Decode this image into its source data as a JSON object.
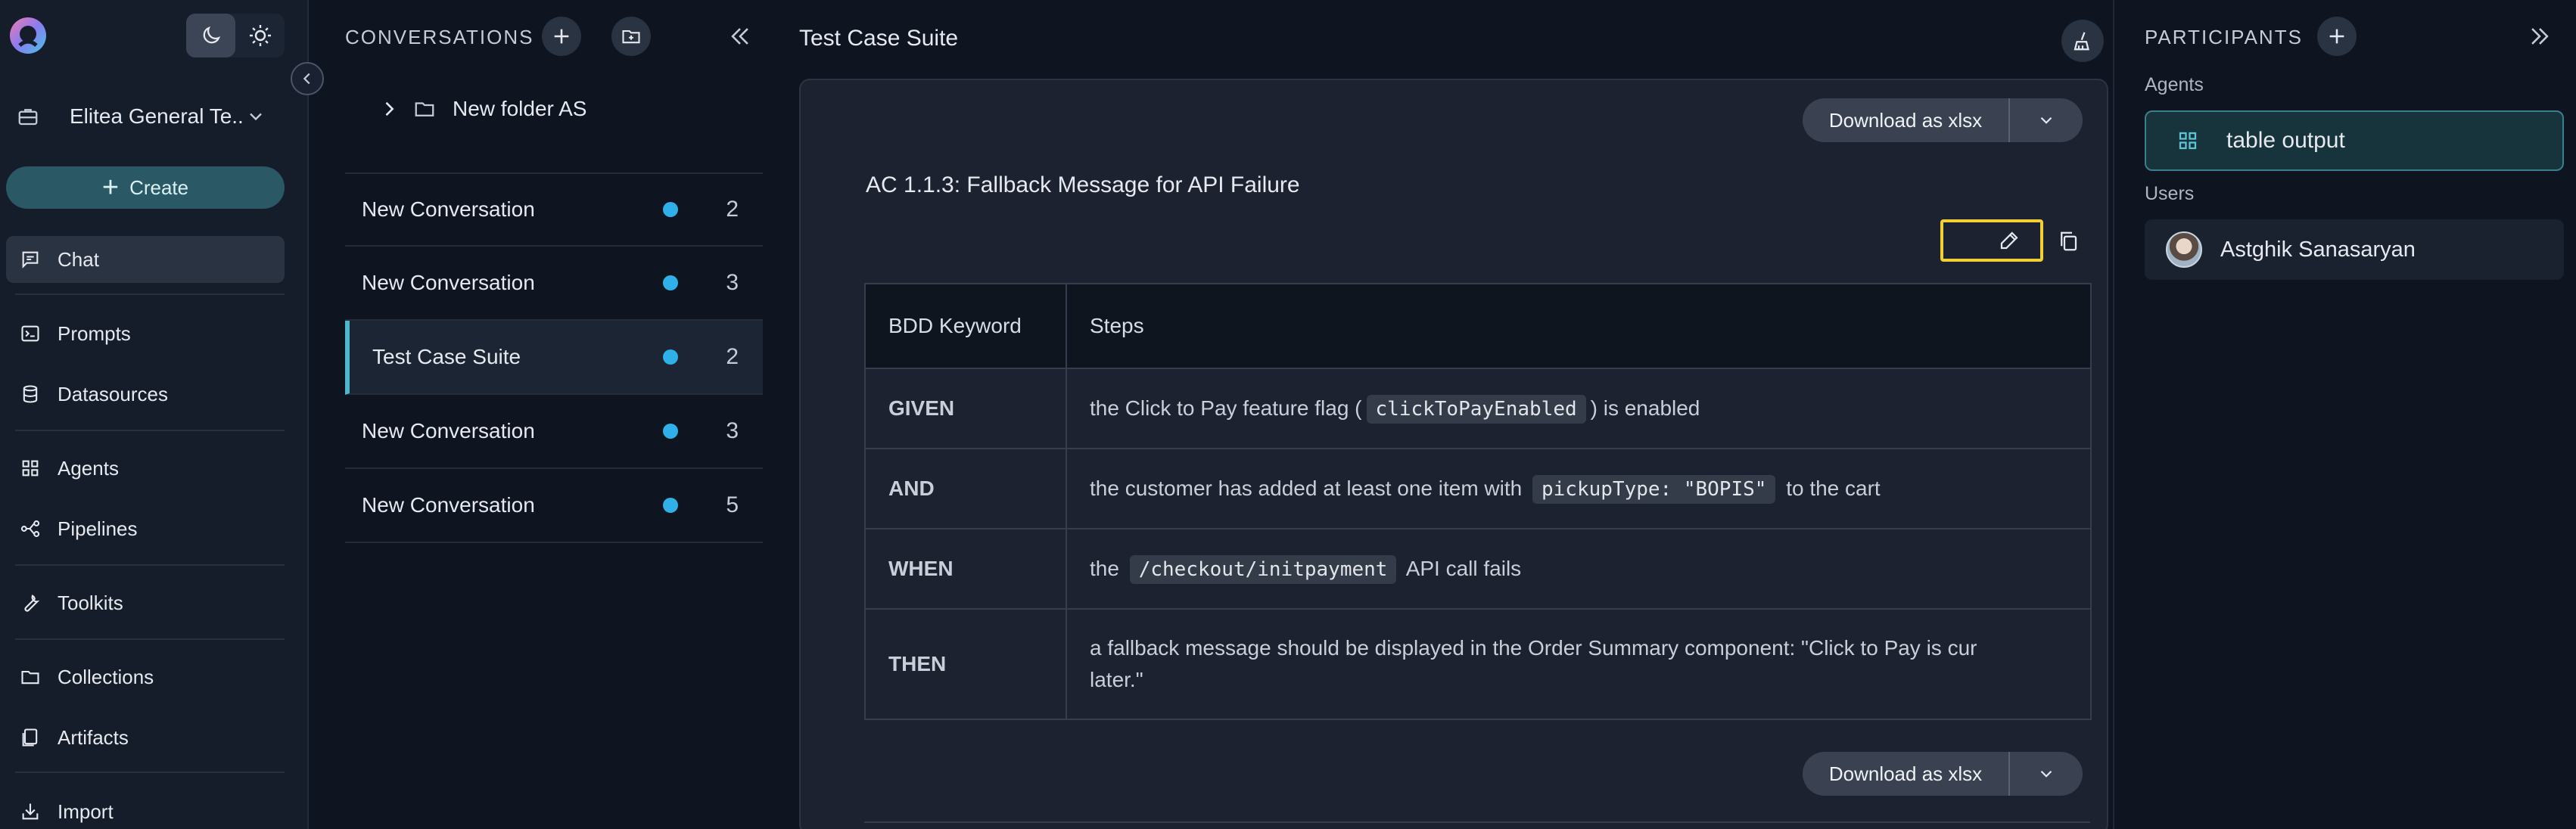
{
  "nav": {
    "project": "Elitea General Te...",
    "create_label": "Create",
    "items": [
      {
        "label": "Chat"
      },
      {
        "label": "Prompts"
      },
      {
        "label": "Datasources"
      },
      {
        "label": "Agents"
      },
      {
        "label": "Pipelines"
      },
      {
        "label": "Toolkits"
      },
      {
        "label": "Collections"
      },
      {
        "label": "Artifacts"
      },
      {
        "label": "Import"
      }
    ]
  },
  "conversations": {
    "title": "CONVERSATIONS",
    "folder": "New folder AS",
    "items": [
      {
        "name": "New Conversation",
        "count": "2"
      },
      {
        "name": "New Conversation",
        "count": "3"
      },
      {
        "name": "Test Case Suite",
        "count": "2"
      },
      {
        "name": "New Conversation",
        "count": "3"
      },
      {
        "name": "New Conversation",
        "count": "5"
      }
    ]
  },
  "main": {
    "title": "Test Case Suite",
    "download_label": "Download as xlsx",
    "ac_title": "AC 1.1.3: Fallback Message for API Failure",
    "table": {
      "headers": [
        "BDD Keyword",
        "Steps"
      ],
      "rows": [
        {
          "keyword": "GIVEN",
          "pre": "the Click to Pay feature flag (",
          "code": "clickToPayEnabled",
          "post": ") is enabled"
        },
        {
          "keyword": "AND",
          "pre": "the customer has added at least one item with",
          "code": "pickupType: \"BOPIS\"",
          "post": "to the cart"
        },
        {
          "keyword": "WHEN",
          "pre": "the",
          "code": "/checkout/initpayment",
          "post": "API call fails"
        },
        {
          "keyword": "THEN",
          "line1": "a fallback message should be displayed in the Order Summary component: \"Click to Pay is cur",
          "line2": "later.\""
        }
      ]
    }
  },
  "participants": {
    "title": "PARTICIPANTS",
    "agents_label": "Agents",
    "agent_name": "table output",
    "users_label": "Users",
    "user_name": "Astghik Sanasaryan"
  },
  "colors": {
    "accent": "#4fb7cc",
    "unread_dot": "#2fb0e8",
    "highlight_border": "#f2d034",
    "create_button": "#2a5864"
  }
}
